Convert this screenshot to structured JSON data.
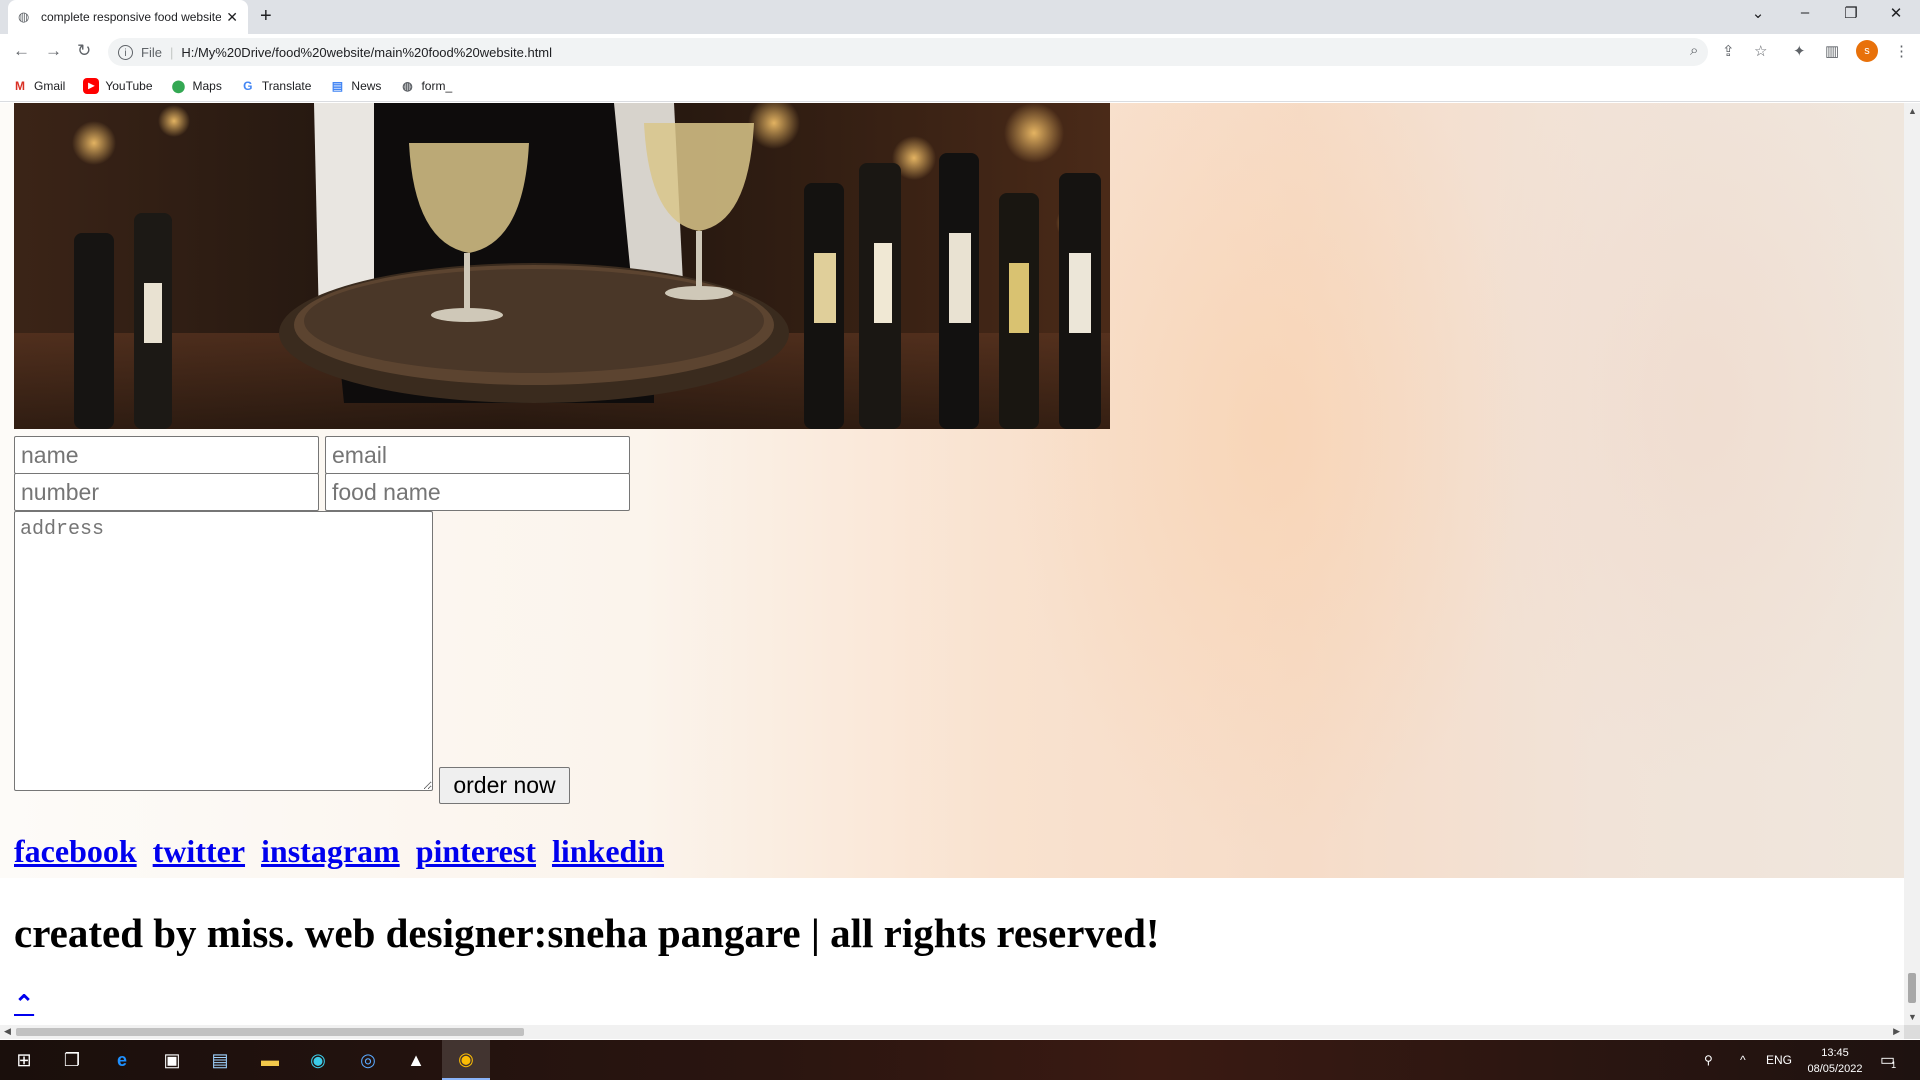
{
  "browser": {
    "tab_title": "complete responsive food website",
    "new_tab_symbol": "+",
    "url_scheme": "File",
    "url": "H:/My%20Drive/food%20website/main%20food%20website.html",
    "profile_initial": "s",
    "bookmarks": [
      {
        "label": "Gmail",
        "icon": "gmail-icon"
      },
      {
        "label": "YouTube",
        "icon": "youtube-icon"
      },
      {
        "label": "Maps",
        "icon": "maps-icon"
      },
      {
        "label": "Translate",
        "icon": "translate-icon"
      },
      {
        "label": "News",
        "icon": "news-icon"
      },
      {
        "label": "form_",
        "icon": "globe-icon"
      }
    ]
  },
  "order_form": {
    "name_placeholder": "name",
    "email_placeholder": "email",
    "number_placeholder": "number",
    "food_placeholder": "food name",
    "address_placeholder": "address",
    "submit_label": "order now"
  },
  "social_links": [
    "facebook",
    "twitter",
    "instagram",
    "pinterest",
    "linkedin"
  ],
  "footer": {
    "credit": "created by miss. web designer:sneha pangare | all rights reserved!",
    "back_to_top": "⌃"
  },
  "taskbar": {
    "language": "ENG",
    "time": "13:45",
    "date": "08/05/2022",
    "notification_count": "1"
  },
  "colors": {
    "link": "#0000ee",
    "profile": "#e8710a",
    "peach_background": "#f9e2cf"
  }
}
